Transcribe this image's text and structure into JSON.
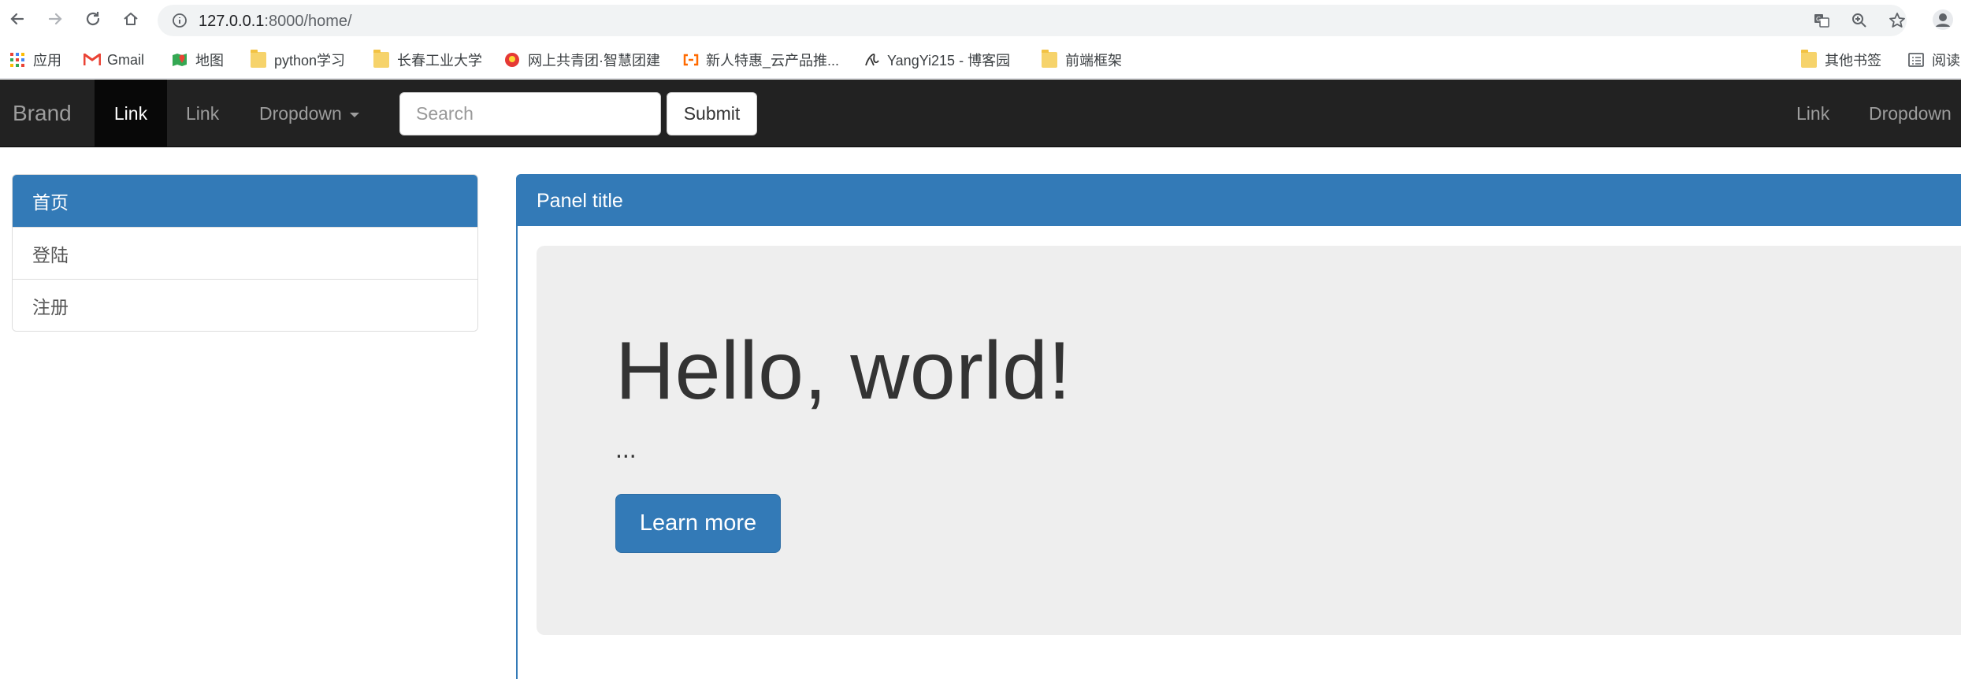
{
  "browser": {
    "url_host": "127.0.0.1",
    "url_path": ":8000/home/",
    "bookmarks": [
      {
        "label": "应用",
        "icon": "apps-grid-icon"
      },
      {
        "label": "Gmail",
        "icon": "gmail-icon"
      },
      {
        "label": "地图",
        "icon": "maps-icon"
      },
      {
        "label": "python学习",
        "icon": "folder-icon"
      },
      {
        "label": "长春工业大学",
        "icon": "folder-icon"
      },
      {
        "label": "网上共青团·智慧团建",
        "icon": "youth-league-icon"
      },
      {
        "label": "新人特惠_云产品推...",
        "icon": "aliyun-icon"
      },
      {
        "label": "YangYi215 - 博客园",
        "icon": "cnblogs-icon"
      },
      {
        "label": "前端框架",
        "icon": "folder-icon"
      }
    ],
    "other_bookmarks": {
      "label": "其他书签",
      "icon": "folder-icon"
    },
    "reading_list": {
      "label": "阅读",
      "icon": "reading-list-icon"
    }
  },
  "navbar": {
    "brand": "Brand",
    "links": [
      {
        "label": "Link",
        "active": true
      },
      {
        "label": "Link",
        "active": false
      },
      {
        "label": "Dropdown",
        "active": false,
        "dropdown": true
      }
    ],
    "search_placeholder": "Search",
    "submit_label": "Submit",
    "right_links": [
      {
        "label": "Link"
      },
      {
        "label": "Dropdown"
      }
    ]
  },
  "sidebar": {
    "items": [
      {
        "label": "首页",
        "active": true
      },
      {
        "label": "登陆",
        "active": false
      },
      {
        "label": "注册",
        "active": false
      }
    ]
  },
  "panel": {
    "title": "Panel title",
    "jumbotron": {
      "heading": "Hello, world!",
      "text": "...",
      "button_label": "Learn more"
    }
  },
  "colors": {
    "primary": "#337ab7",
    "navbar_bg": "#222222",
    "navbar_active": "#080808",
    "jumbotron_bg": "#eeeeee"
  }
}
